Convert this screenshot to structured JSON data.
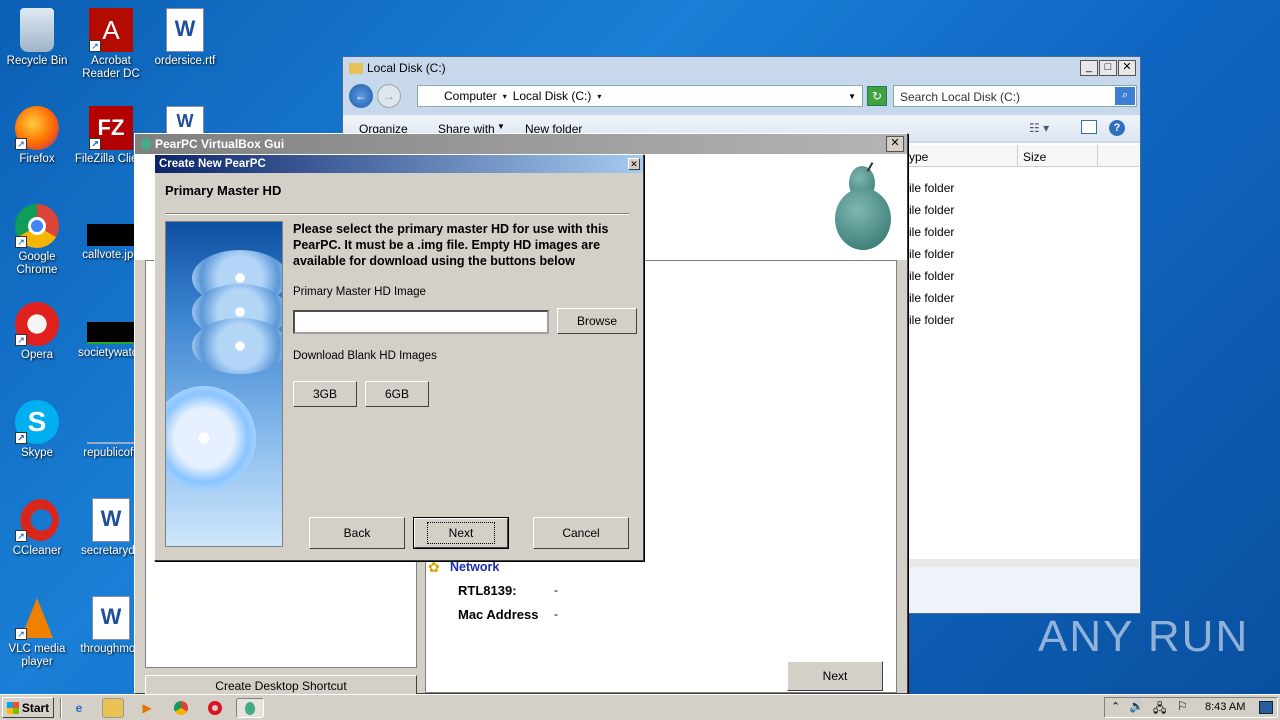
{
  "desktop": {
    "icons": [
      {
        "label": "Recycle Bin",
        "glyph": "🗑"
      },
      {
        "label": "Acrobat Reader DC",
        "glyph": "A"
      },
      {
        "label": "ordersice.rtf",
        "glyph": "W"
      },
      {
        "label": "Firefox",
        "glyph": "●"
      },
      {
        "label": "FileZilla Client",
        "glyph": "FZ"
      },
      {
        "label": "Google Chrome",
        "glyph": "◉"
      },
      {
        "label": "callvote.jpg",
        "glyph": ""
      },
      {
        "label": "Opera",
        "glyph": "O"
      },
      {
        "label": "societywatch",
        "glyph": ""
      },
      {
        "label": "Skype",
        "glyph": "S"
      },
      {
        "label": "republicoffi",
        "glyph": ""
      },
      {
        "label": "CCleaner",
        "glyph": "C"
      },
      {
        "label": "secretaryde",
        "glyph": "W"
      },
      {
        "label": "VLC media player",
        "glyph": "▲"
      },
      {
        "label": "throughmon",
        "glyph": "W"
      }
    ]
  },
  "explorer": {
    "title": "Local Disk (C:)",
    "breadcrumb": [
      "Computer",
      "Local Disk (C:)"
    ],
    "search_placeholder": "Search Local Disk (C:)",
    "toolbar": {
      "organize": "Organize",
      "share_with": "Share with",
      "new_folder": "New folder"
    },
    "columns": {
      "type": "ype",
      "size": "Size"
    },
    "rows": [
      "ile folder",
      "ile folder",
      "ile folder",
      "ile folder",
      "ile folder",
      "ile folder",
      "ile folder"
    ]
  },
  "pearpc_window": {
    "title": "PearPC VirtualBox Gui",
    "network_label": "Network",
    "rtl_label": "RTL8139:",
    "rtl_value": "-",
    "mac_label": "Mac Address",
    "mac_value": "-",
    "next_label": "Next",
    "shortcut_label": "Create Desktop Shortcut"
  },
  "dialog": {
    "title": "Create New PearPC",
    "heading": "Primary Master HD",
    "description": "Please select the primary master HD for use with this PearPC. It must be a .img file. Empty HD images are available for download using the buttons below",
    "hd_image_label": "Primary Master HD Image",
    "hd_image_value": "",
    "browse_label": "Browse",
    "download_label": "Download Blank HD Images",
    "btn_3gb": "3GB",
    "btn_6gb": "6GB",
    "back_label": "Back",
    "next_label": "Next",
    "cancel_label": "Cancel"
  },
  "taskbar": {
    "start_label": "Start",
    "clock": "8:43 AM"
  },
  "watermark": "ANY RUN"
}
